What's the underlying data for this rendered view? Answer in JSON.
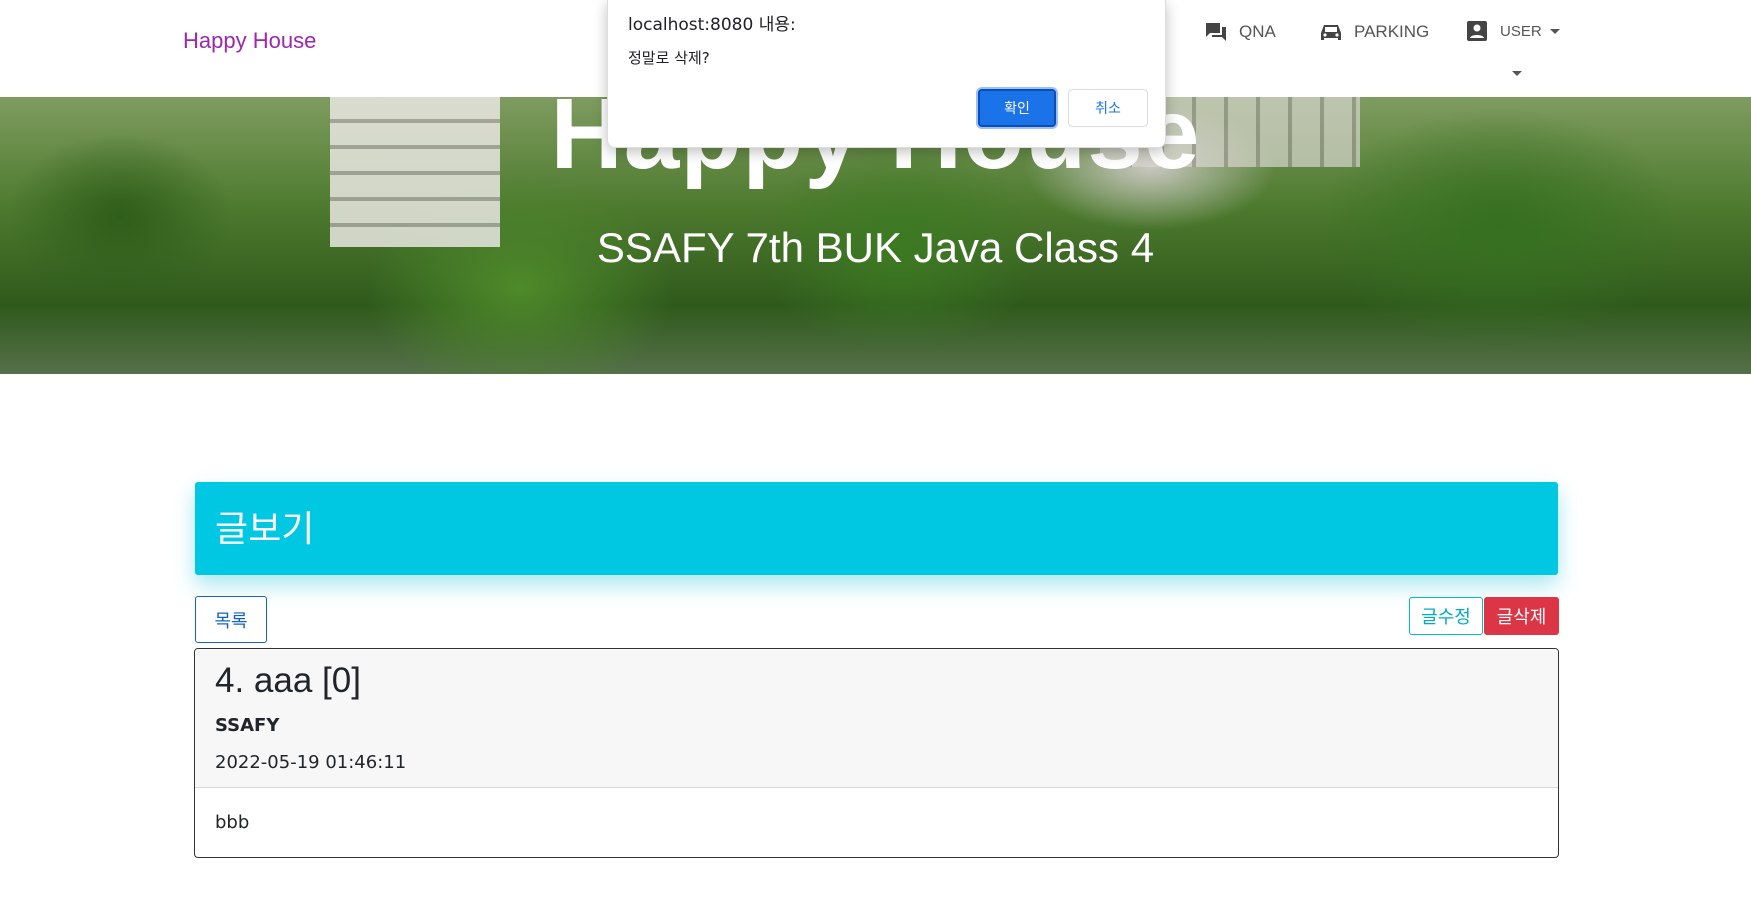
{
  "navbar": {
    "brand": "Happy House",
    "items": [
      {
        "label": "QNA",
        "icon": "forum-icon"
      },
      {
        "label": "PARKING",
        "icon": "car-icon"
      },
      {
        "label": "USER",
        "icon": "account-box-icon"
      }
    ]
  },
  "hero": {
    "title": "Happy House",
    "subtitle": "SSAFY 7th BUK Java Class 4"
  },
  "dialog": {
    "title": "localhost:8080 내용:",
    "message": "정말로 삭제?",
    "ok_label": "확인",
    "cancel_label": "취소"
  },
  "card": {
    "header_title": "글보기",
    "list_button": "목록",
    "edit_button": "글수정",
    "delete_button": "글삭제"
  },
  "article": {
    "title": "4. aaa [0]",
    "author": "SSAFY",
    "date": "2022-05-19 01:46:11",
    "content": "bbb"
  },
  "colors": {
    "brand": "#9c27b0",
    "header_accent": "#00c8e3",
    "delete": "#dc3545",
    "dialog_primary": "#1a73e8"
  }
}
